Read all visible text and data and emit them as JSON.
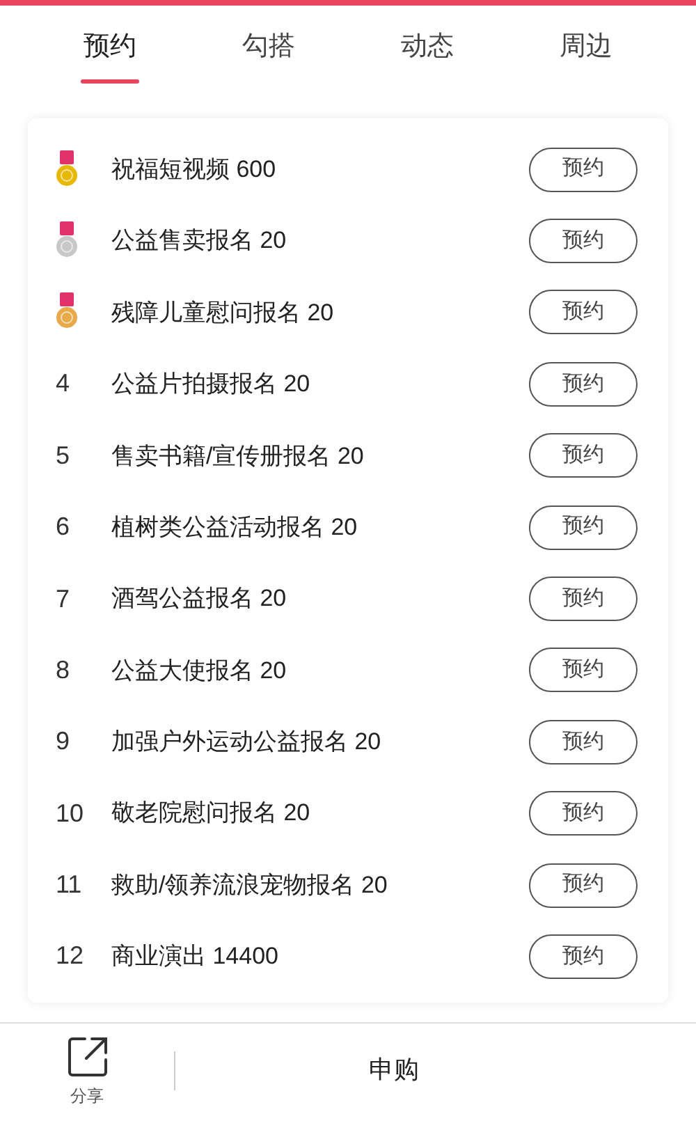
{
  "tabs": [
    {
      "label": "预约",
      "selected": true
    },
    {
      "label": "勾搭",
      "selected": false
    },
    {
      "label": "动态",
      "selected": false
    },
    {
      "label": "周边",
      "selected": false
    }
  ],
  "items": [
    {
      "kind": "medal",
      "color": "#e6b800",
      "title": "祝福短视频 600",
      "button": "预约"
    },
    {
      "kind": "medal",
      "color": "#c8c8c8",
      "title": "公益售卖报名 20",
      "button": "预约"
    },
    {
      "kind": "medal",
      "color": "#e8a94a",
      "title": "残障儿童慰问报名 20",
      "button": "预约"
    },
    {
      "kind": "number",
      "rank": "4",
      "title": "公益片拍摄报名 20",
      "button": "预约"
    },
    {
      "kind": "number",
      "rank": "5",
      "title": "售卖书籍/宣传册报名 20",
      "button": "预约"
    },
    {
      "kind": "number",
      "rank": "6",
      "title": "植树类公益活动报名 20",
      "button": "预约"
    },
    {
      "kind": "number",
      "rank": "7",
      "title": "酒驾公益报名 20",
      "button": "预约"
    },
    {
      "kind": "number",
      "rank": "8",
      "title": "公益大使报名 20",
      "button": "预约"
    },
    {
      "kind": "number",
      "rank": "9",
      "title": "加强户外运动公益报名 20",
      "button": "预约"
    },
    {
      "kind": "number",
      "rank": "10",
      "title": "敬老院慰问报名 20",
      "button": "预约"
    },
    {
      "kind": "number",
      "rank": "11",
      "title": "救助/领养流浪宠物报名 20",
      "button": "预约"
    },
    {
      "kind": "number",
      "rank": "12",
      "title": "商业演出 14400",
      "button": "预约"
    }
  ],
  "bottom_bar": {
    "share": "分享",
    "action": "申购"
  }
}
